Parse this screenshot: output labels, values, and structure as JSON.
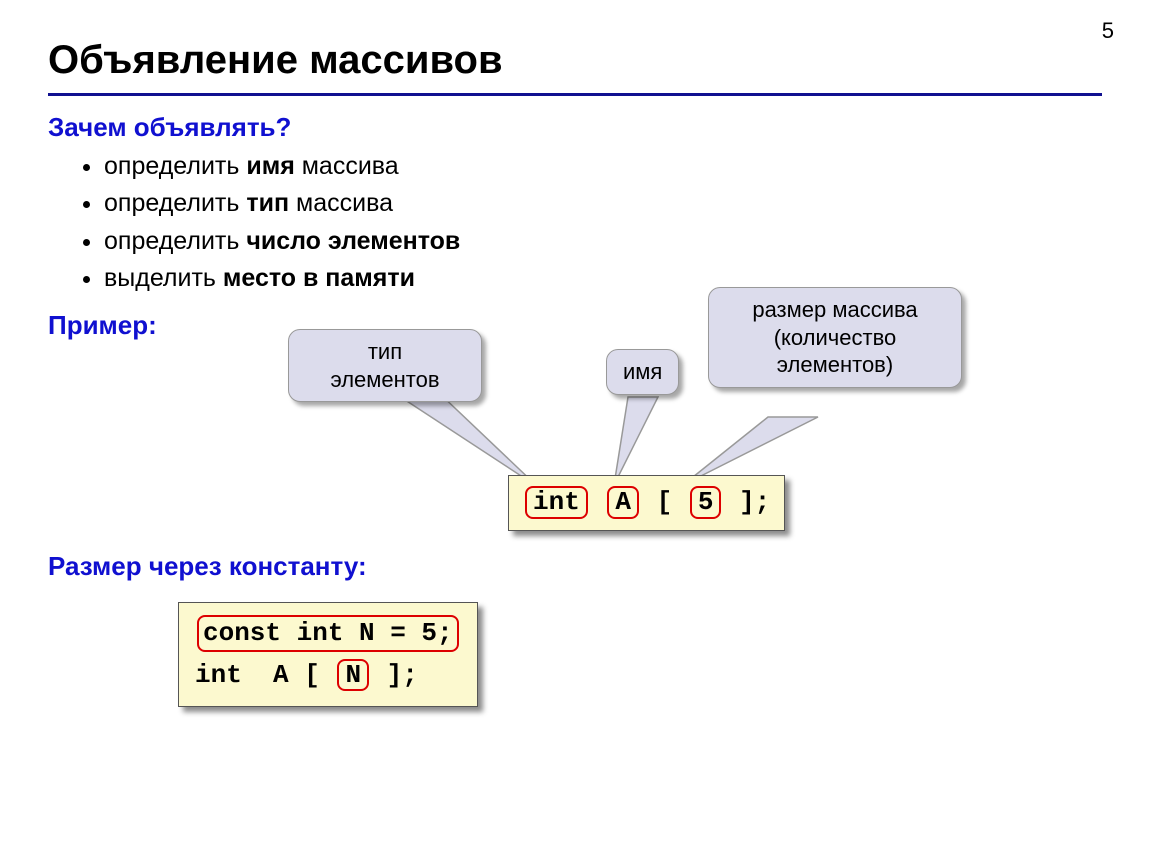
{
  "page_number": "5",
  "title": "Объявление массивов",
  "sections": {
    "why": {
      "heading": "Зачем объявлять?",
      "bullets": [
        {
          "pre": "определить ",
          "bold": "имя",
          "post": " массива"
        },
        {
          "pre": "определить ",
          "bold": "тип",
          "post": " массива"
        },
        {
          "pre": "определить ",
          "bold": "число элементов",
          "post": ""
        },
        {
          "pre": "выделить ",
          "bold": "место в памяти",
          "post": ""
        }
      ]
    },
    "example": {
      "heading": "Пример:",
      "callout_type": "тип\nэлементов",
      "callout_name": "имя",
      "callout_size": "размер массива\n(количество\nэлементов)",
      "code": {
        "kw_int": "int",
        "name": "A",
        "lbracket": "[",
        "size": "5",
        "rbracket_semi": "];"
      }
    },
    "const": {
      "heading": "Размер через константу:",
      "line1": "const int N = 5;",
      "line2": {
        "prefix": "int  A [ ",
        "N": "N",
        "suffix": " ];"
      }
    }
  }
}
